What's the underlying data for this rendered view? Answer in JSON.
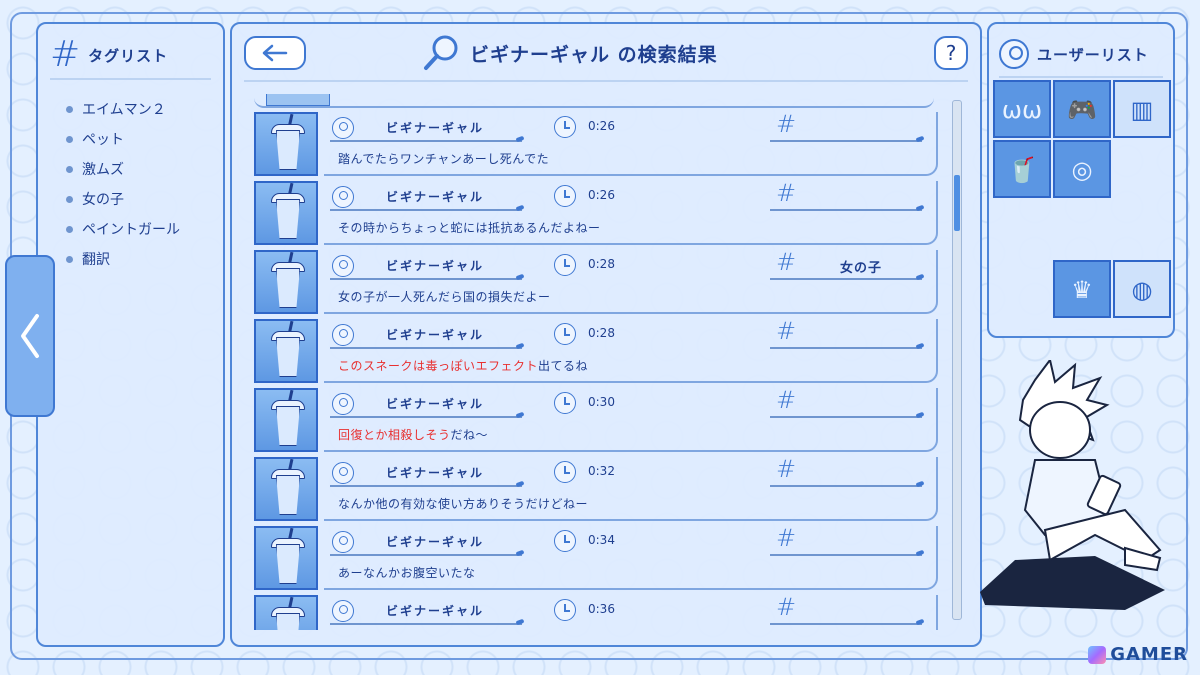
{
  "tag_panel": {
    "title": "タグリスト",
    "items": [
      "エイムマン２",
      "ペット",
      "激ムズ",
      "女の子",
      "ペイントガール",
      "翻訳"
    ]
  },
  "search": {
    "title": "ビギナーギャル の検索結果"
  },
  "help_label": "?",
  "results": [
    {
      "user": "ビギナーギャル",
      "time": "0:26",
      "tag": "",
      "comment_red": "",
      "comment": "踏んでたらワンチャンあーし死んでた"
    },
    {
      "user": "ビギナーギャル",
      "time": "0:26",
      "tag": "",
      "comment_red": "",
      "comment": "その時からちょっと蛇には抵抗あるんだよねー"
    },
    {
      "user": "ビギナーギャル",
      "time": "0:28",
      "tag": "女の子",
      "comment_red": "",
      "comment": "女の子が一人死んだら国の損失だよー"
    },
    {
      "user": "ビギナーギャル",
      "time": "0:28",
      "tag": "",
      "comment_red": "このスネークは毒っぽいエフェクト",
      "comment": "出てるね"
    },
    {
      "user": "ビギナーギャル",
      "time": "0:30",
      "tag": "",
      "comment_red": "回復とか相殺しそう",
      "comment": "だね～"
    },
    {
      "user": "ビギナーギャル",
      "time": "0:32",
      "tag": "",
      "comment_red": "",
      "comment": "なんか他の有効な使い方ありそうだけどねー"
    },
    {
      "user": "ビギナーギャル",
      "time": "0:34",
      "tag": "",
      "comment_red": "",
      "comment": "あーなんかお腹空いたな"
    },
    {
      "user": "ビギナーギャル",
      "time": "0:36",
      "tag": "",
      "comment_red": "",
      "comment": ""
    }
  ],
  "user_panel": {
    "title": "ユーザーリスト",
    "avatars": [
      {
        "name": "laughing-face-avatar",
        "glyph": "ωω"
      },
      {
        "name": "gamepad-avatar",
        "glyph": "🎮"
      },
      {
        "name": "cup-noodle-avatar",
        "glyph": "▥"
      },
      {
        "name": "drink-cup-avatar",
        "glyph": "🥤"
      },
      {
        "name": "brain-avatar",
        "glyph": "◎"
      },
      {
        "name": "maid-silhouette-avatar",
        "glyph": "♛"
      },
      {
        "name": "globe-avatar",
        "glyph": "◍"
      }
    ]
  },
  "watermark": "GAMER",
  "colors": {
    "accent": "#3f78d2",
    "highlight_text": "#e83030",
    "panel_bg": "#deecff"
  }
}
